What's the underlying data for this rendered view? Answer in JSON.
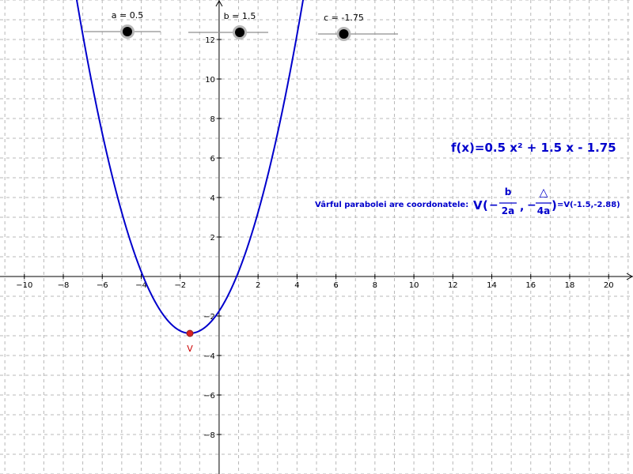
{
  "chart_data": {
    "type": "line",
    "series": [
      {
        "name": "f",
        "function": "a*x^2 + b*x + c",
        "color": "#0000cc"
      }
    ],
    "axes": {
      "x_range": [
        -11.25,
        21.25
      ],
      "y_range": [
        -10,
        14
      ],
      "x_ticks": [
        -10,
        -8,
        -6,
        -4,
        -2,
        2,
        4,
        6,
        8,
        10,
        12,
        14,
        16,
        18,
        20
      ],
      "y_ticks": [
        -8,
        -6,
        -4,
        -2,
        2,
        4,
        6,
        8,
        10,
        12
      ],
      "grid": true
    },
    "parameters": {
      "a": 0.5,
      "b": 1.5,
      "c": -1.75
    },
    "vertex": {
      "label": "V",
      "x": -1.5,
      "y": -2.88,
      "color": "#dd2222"
    },
    "colors": {
      "curve": "#0000cc",
      "text": "#0000cc",
      "point": "#dd2222",
      "grid": "#b8b8b8",
      "axis": "#000000",
      "slider_track": "#8f8f8f"
    }
  },
  "sliders": [
    {
      "name": "a",
      "label": "a = 0.5",
      "value": 0.5,
      "min": -5,
      "max": 5
    },
    {
      "name": "b",
      "label": "b = 1.5",
      "value": 1.5,
      "min": -5,
      "max": 5
    },
    {
      "name": "c",
      "label": "c = -1.75",
      "value": -1.75,
      "min": -5,
      "max": 5
    }
  ],
  "formula": {
    "function_text": "f(x)=0.5 x² + 1.5 x - 1.75",
    "vertex_intro": "Vârful parabolei are coordonatele:",
    "vertex_v": "V",
    "open_paren": "(",
    "close_paren": ")",
    "minus1": "−",
    "minus2": "−",
    "comma": ",",
    "numerator_b": "b",
    "denominator_2a": "2a",
    "numerator_delta": "△",
    "denominator_4a": "4a",
    "vertex_value": "=V(-1.5,-2.88)"
  }
}
